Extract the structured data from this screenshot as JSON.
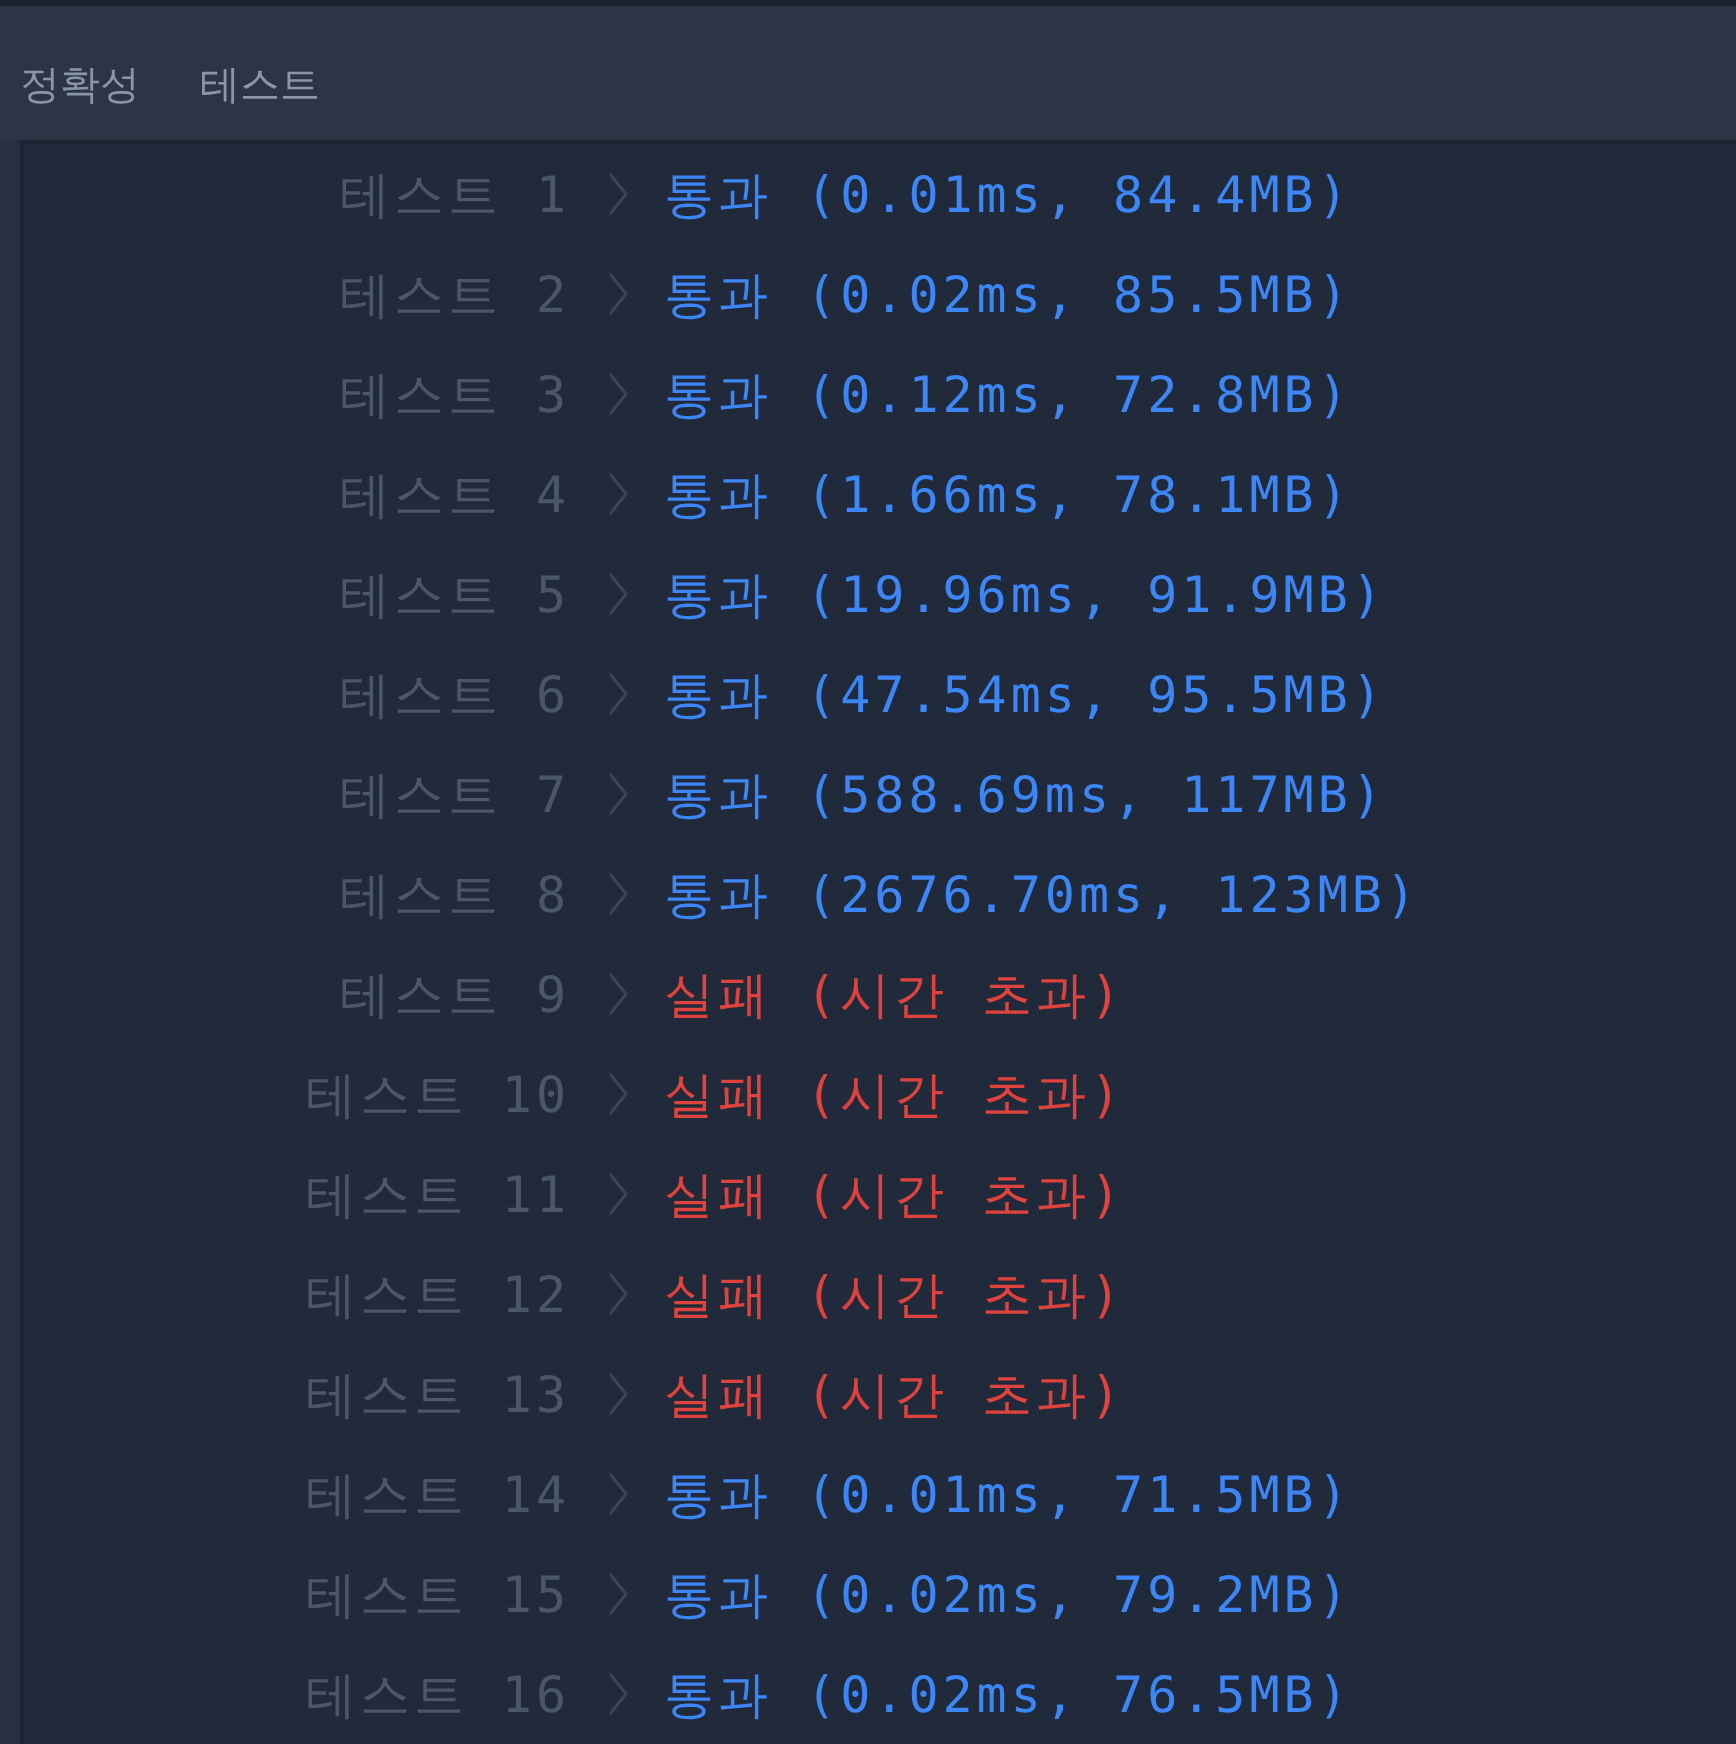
{
  "tabs": [
    {
      "label": "정확성"
    },
    {
      "label": "테스트"
    }
  ],
  "results": [
    {
      "label": "테스트 1",
      "kind": "pass",
      "result": "통과 (0.01ms, 84.4MB)"
    },
    {
      "label": "테스트 2",
      "kind": "pass",
      "result": "통과 (0.02ms, 85.5MB)"
    },
    {
      "label": "테스트 3",
      "kind": "pass",
      "result": "통과 (0.12ms, 72.8MB)"
    },
    {
      "label": "테스트 4",
      "kind": "pass",
      "result": "통과 (1.66ms, 78.1MB)"
    },
    {
      "label": "테스트 5",
      "kind": "pass",
      "result": "통과 (19.96ms, 91.9MB)"
    },
    {
      "label": "테스트 6",
      "kind": "pass",
      "result": "통과 (47.54ms, 95.5MB)"
    },
    {
      "label": "테스트 7",
      "kind": "pass",
      "result": "통과 (588.69ms, 117MB)"
    },
    {
      "label": "테스트 8",
      "kind": "pass",
      "result": "통과 (2676.70ms, 123MB)"
    },
    {
      "label": "테스트 9",
      "kind": "fail",
      "result": "실패 (시간 초과)"
    },
    {
      "label": "테스트 10",
      "kind": "fail",
      "result": "실패 (시간 초과)"
    },
    {
      "label": "테스트 11",
      "kind": "fail",
      "result": "실패 (시간 초과)"
    },
    {
      "label": "테스트 12",
      "kind": "fail",
      "result": "실패 (시간 초과)"
    },
    {
      "label": "테스트 13",
      "kind": "fail",
      "result": "실패 (시간 초과)"
    },
    {
      "label": "테스트 14",
      "kind": "pass",
      "result": "통과 (0.01ms, 71.5MB)"
    },
    {
      "label": "테스트 15",
      "kind": "pass",
      "result": "통과 (0.02ms, 79.2MB)"
    },
    {
      "label": "테스트 16",
      "kind": "pass",
      "result": "통과 (0.02ms, 76.5MB)"
    }
  ]
}
